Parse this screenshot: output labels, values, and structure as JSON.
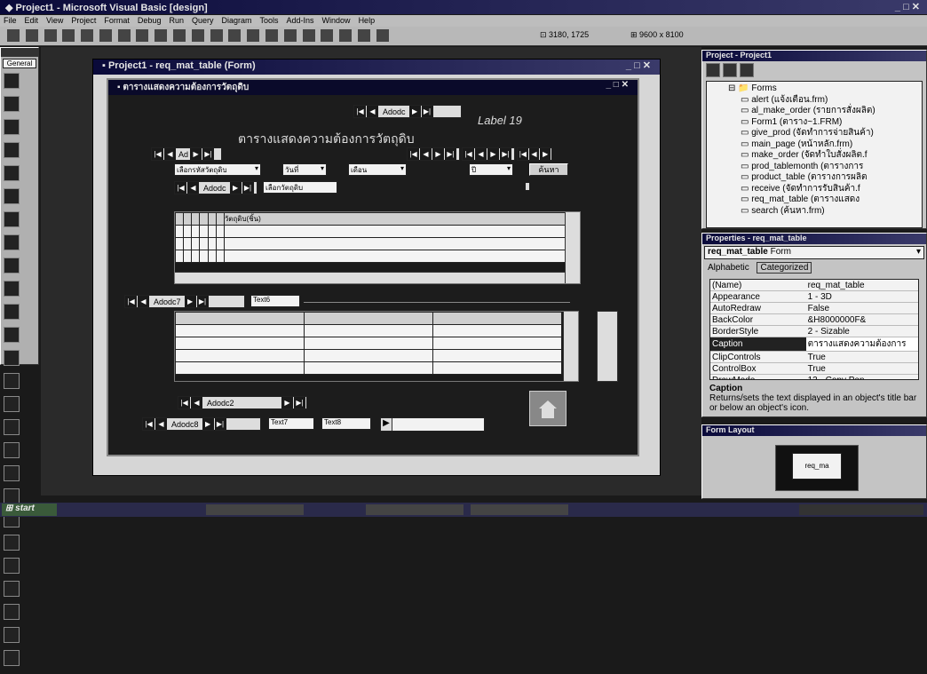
{
  "ide": {
    "title": "Project1 - Microsoft Visual Basic [design]",
    "menu": [
      "File",
      "Edit",
      "View",
      "Project",
      "Format",
      "Debug",
      "Run",
      "Query",
      "Diagram",
      "Tools",
      "Add-Ins",
      "Window",
      "Help"
    ],
    "toolbar": {
      "position": "3180, 1725",
      "size": "9600 x 8100"
    }
  },
  "toolbox": {
    "title": "General"
  },
  "form_window": {
    "title": "Project1 - req_mat_table (Form)"
  },
  "form": {
    "caption": "ตารางแสดงความต้องการวัตถุดิบ",
    "top_nav": {
      "caption": "Adodc"
    },
    "heading_label": "ตารางแสดงความต้องการวัตถุดิบ",
    "lbl1": "Label 19",
    "combo1": "เลือกรหัสวัตถุดิบ",
    "combo2": "วันที่",
    "combo3": "เดือน",
    "combo4": "ปี",
    "search_btn": "ค้นหา",
    "nav2": {
      "caption": "Adodc",
      "text": "เลือกวัตถุดิบ"
    },
    "grid1_header": "วัตถุดิบ(ชิ้น)",
    "adodc7": "Adodc7",
    "text6": "Text6",
    "adodc2": "Adodc2",
    "adodc8": "Adodc8",
    "text7": "Text7",
    "text8": "Text8"
  },
  "project": {
    "title": "Project - Project1",
    "forms_label": "Forms",
    "items": [
      "alert (แจ้งเตือน.frm)",
      "al_make_order (รายการสั่งผลิต)",
      "Form1 (ตาราง~1.FRM)",
      "give_prod (จัดทำการจ่ายสินค้า)",
      "main_page (หน้าหลัก.frm)",
      "make_order (จัดทำใบสั่งผลิต.f",
      "prod_tablemonth (ตารางการ",
      "product_table (ตารางการผลิต",
      "receive (จัดทำการรับสินค้า.f",
      "req_mat_table (ตารางแสดง",
      "search (ค้นหา.frm)"
    ]
  },
  "properties": {
    "title": "Properties - req_mat_table",
    "object": "req_mat_table",
    "object_type": "Form",
    "tabs": [
      "Alphabetic",
      "Categorized"
    ],
    "rows": [
      {
        "name": "(Name)",
        "value": "req_mat_table"
      },
      {
        "name": "Appearance",
        "value": "1 - 3D"
      },
      {
        "name": "AutoRedraw",
        "value": "False"
      },
      {
        "name": "BackColor",
        "value": "&H8000000F&"
      },
      {
        "name": "BorderStyle",
        "value": "2 - Sizable"
      },
      {
        "name": "Caption",
        "value": "ตารางแสดงความต้องการ"
      },
      {
        "name": "ClipControls",
        "value": "True"
      },
      {
        "name": "ControlBox",
        "value": "True"
      },
      {
        "name": "DrawMode",
        "value": "13 - Copy Pen"
      }
    ],
    "desc_title": "Caption",
    "desc_text": "Returns/sets the text displayed in an object's title bar or below an object's icon."
  },
  "layout_window": {
    "title": "Form Layout",
    "thumb_label": "req_ma"
  },
  "taskbar": {
    "start": "start"
  }
}
